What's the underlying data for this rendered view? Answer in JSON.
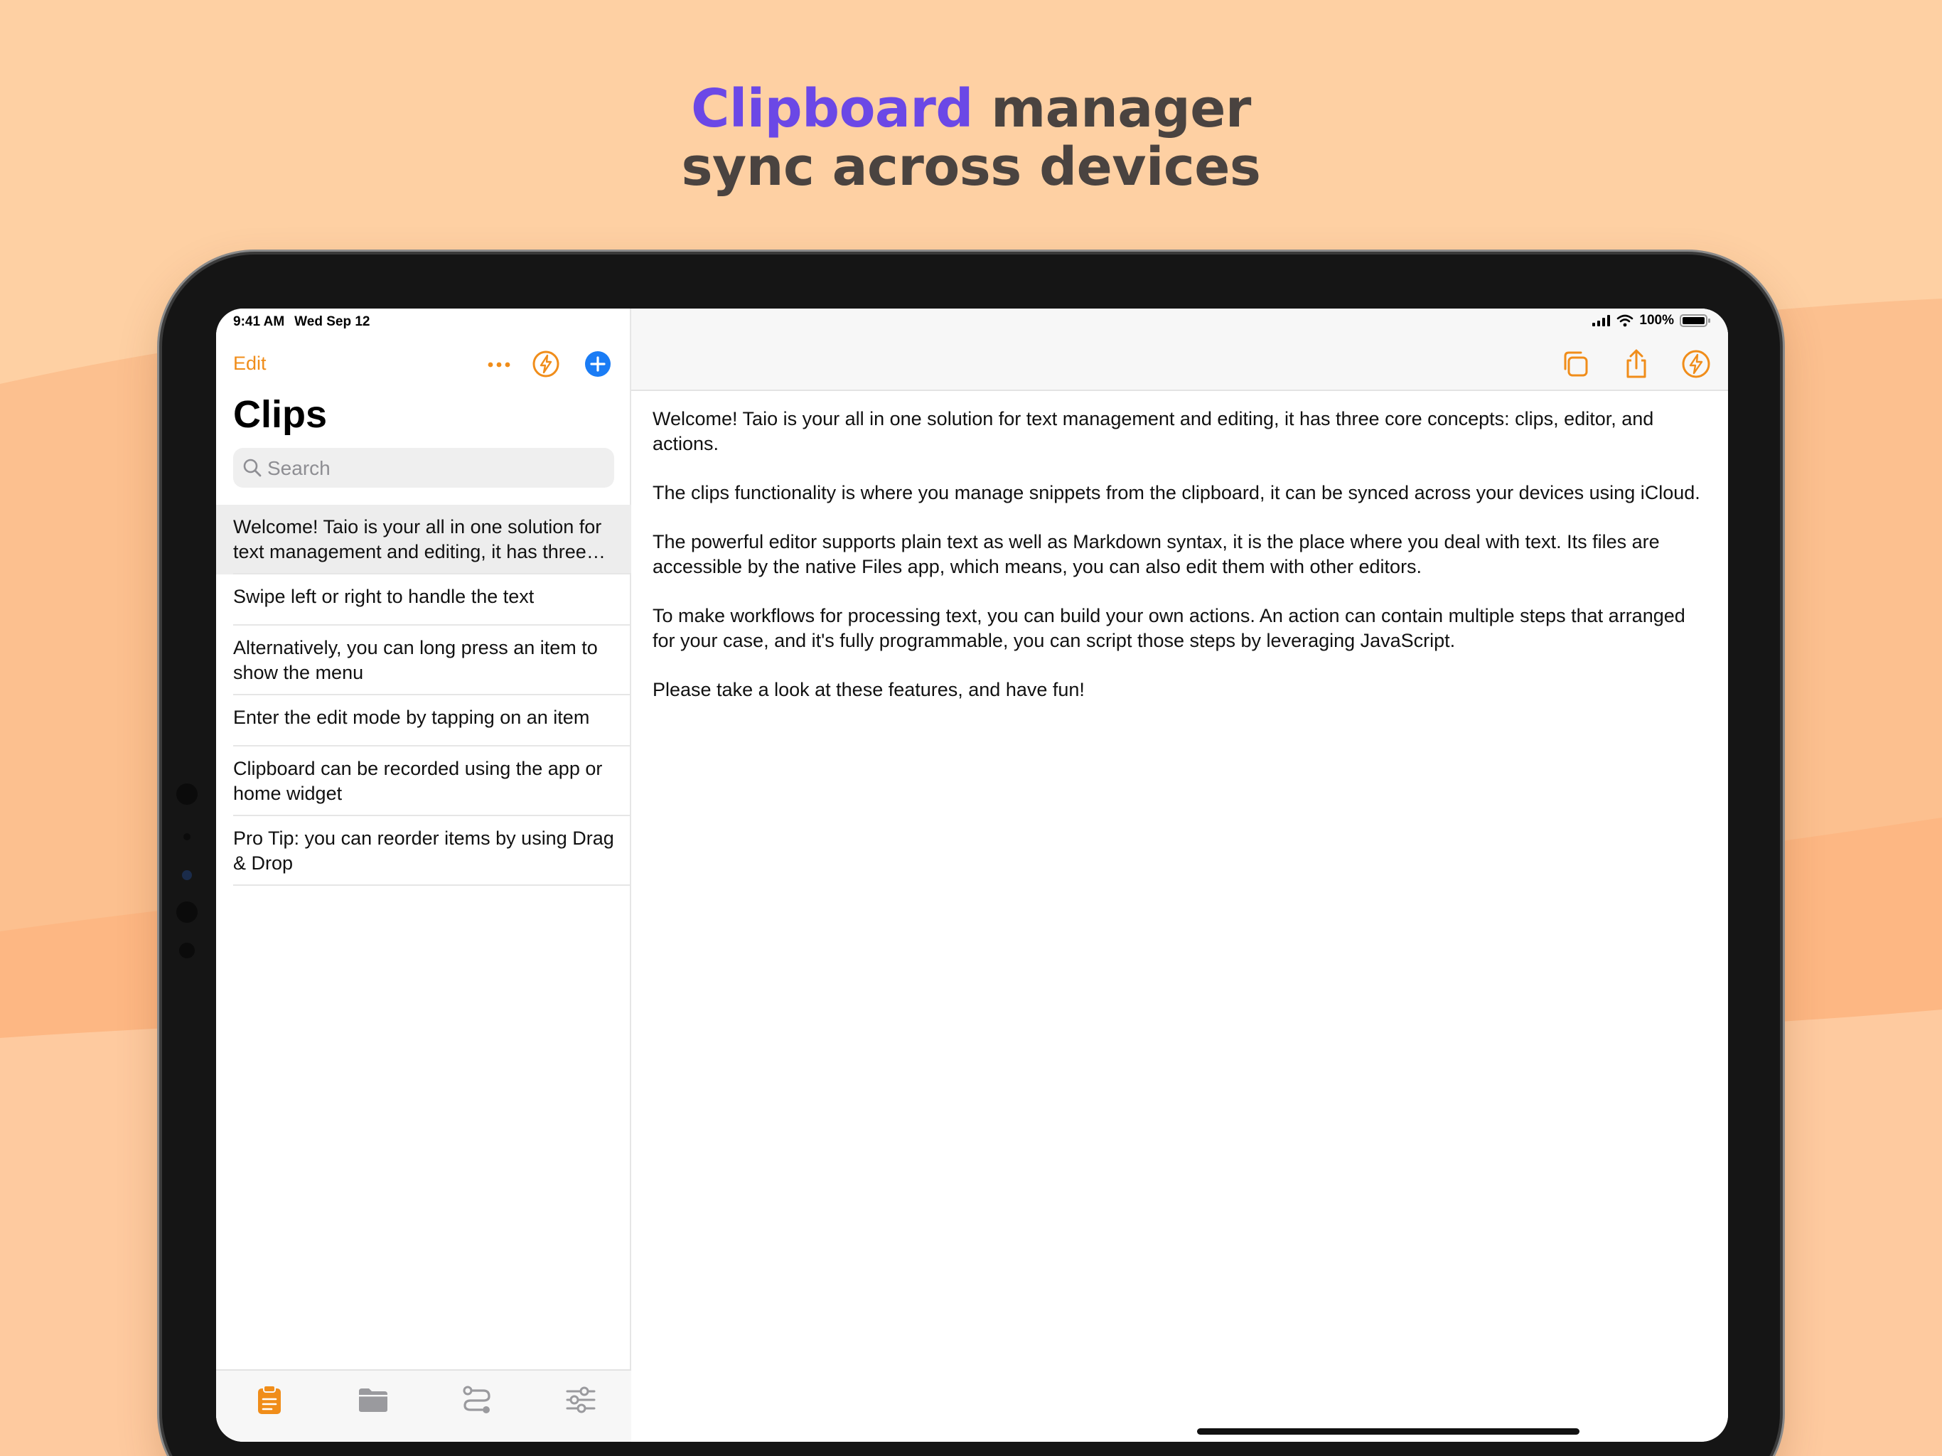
{
  "headline": {
    "accent": "Clipboard",
    "rest_line1": " manager",
    "line2": "sync across devices"
  },
  "colors": {
    "accent_purple": "#6b48e6",
    "accent_orange": "#f08d1a",
    "add_blue": "#1a7cf5",
    "background": "#fed0a3"
  },
  "status_bar": {
    "time": "9:41 AM",
    "date": "Wed Sep 12",
    "battery": "100%"
  },
  "sidebar": {
    "edit_label": "Edit",
    "title": "Clips",
    "search_placeholder": "Search",
    "icons": [
      "more-icon",
      "bolt-icon",
      "add-icon"
    ],
    "items": [
      {
        "text": "Welcome! Taio is your all in one solution for text management and editing, it has three core concepts: clips, editor, and actions.",
        "selected": true
      },
      {
        "text": "Swipe left or right to handle the text",
        "selected": false
      },
      {
        "text": "Alternatively, you can long press an item to show the menu",
        "selected": false
      },
      {
        "text": "Enter the edit mode by tapping on an item",
        "selected": false
      },
      {
        "text": "Clipboard can be recorded using the app or home widget",
        "selected": false
      },
      {
        "text": "Pro Tip: you can reorder items by using Drag & Drop",
        "selected": false
      }
    ],
    "tabs": [
      "clipboard-tab-icon",
      "folder-tab-icon",
      "actions-tab-icon",
      "settings-tab-icon"
    ]
  },
  "detail": {
    "toolbar_icons": [
      "copy-icon",
      "share-icon",
      "bolt-icon"
    ],
    "paragraphs": [
      "Welcome! Taio is your all in one solution for text management and editing, it has three core concepts: clips, editor, and actions.",
      "The clips functionality is where you manage snippets from the clipboard, it can be synced across your devices using iCloud.",
      "The powerful editor supports plain text as well as Markdown syntax, it is the place where you deal with text. Its files are accessible by the native Files app, which means, you can also edit them with other editors.",
      "To make workflows for processing text, you can build your own actions. An action can contain multiple steps that arranged for your case, and it's fully programmable, you can script those steps by leveraging JavaScript.",
      "Please take a look at these features, and have fun!"
    ]
  }
}
